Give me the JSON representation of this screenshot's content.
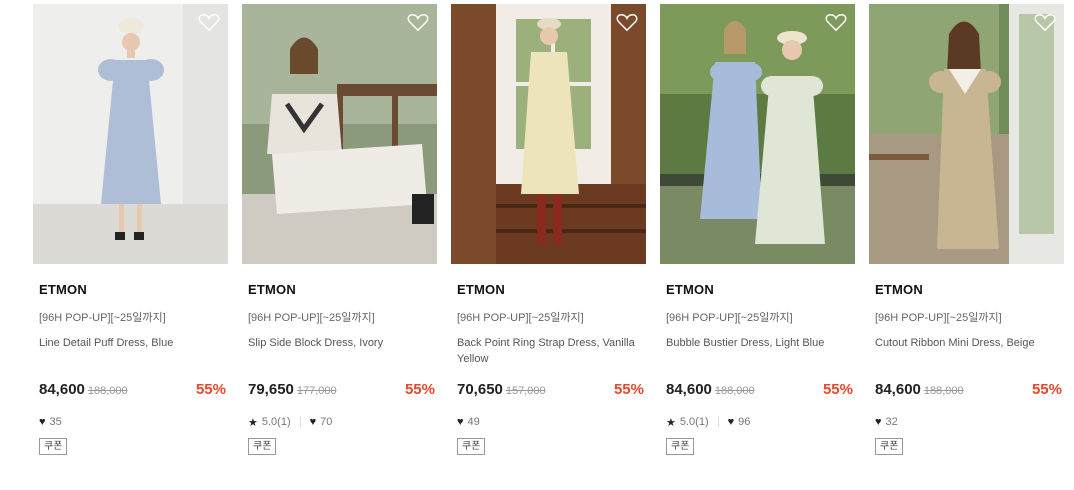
{
  "products": [
    {
      "brand": "ETMON",
      "tag": "[96H POP-UP][~25일까지]",
      "name": "Line Detail Puff Dress, Blue",
      "price": "84,600",
      "original_price": "188,000",
      "discount": "55%",
      "rating": "",
      "likes": "35",
      "coupon": "쿠폰",
      "colors": {
        "bg": "#e9e9e7",
        "floor": "#d9d7d2",
        "dress": "#a9bcd6"
      }
    },
    {
      "brand": "ETMON",
      "tag": "[96H POP-UP][~25일까지]",
      "name": "Slip Side Block Dress, Ivory",
      "price": "79,650",
      "original_price": "177,000",
      "discount": "55%",
      "rating": "5.0(1)",
      "likes": "70",
      "coupon": "쿠폰",
      "colors": {
        "bg": "#7a8c6a",
        "floor": "#6b4a33",
        "dress": "#ece8e0"
      }
    },
    {
      "brand": "ETMON",
      "tag": "[96H POP-UP][~25일까지]",
      "name": "Back Point Ring Strap Dress, Vanilla Yellow",
      "price": "70,650",
      "original_price": "157,000",
      "discount": "55%",
      "rating": "",
      "likes": "49",
      "coupon": "쿠폰",
      "colors": {
        "bg": "#8a5a3a",
        "floor": "#5e3520",
        "dress": "#efe6bf"
      }
    },
    {
      "brand": "ETMON",
      "tag": "[96H POP-UP][~25일까지]",
      "name": "Bubble Bustier Dress, Light Blue",
      "price": "84,600",
      "original_price": "188,000",
      "discount": "55%",
      "rating": "5.0(1)",
      "likes": "96",
      "coupon": "쿠폰",
      "colors": {
        "bg": "#5f7a45",
        "floor": "#8a9a6a",
        "dress": "#aabfdd"
      }
    },
    {
      "brand": "ETMON",
      "tag": "[96H POP-UP][~25일까지]",
      "name": "Cutout Ribbon Mini Dress, Beige",
      "price": "84,600",
      "original_price": "188,000",
      "discount": "55%",
      "rating": "",
      "likes": "32",
      "coupon": "쿠폰",
      "colors": {
        "bg": "#6e8a5a",
        "floor": "#a89a82",
        "dress": "#c7b48f"
      }
    }
  ],
  "icons": {
    "wishlist": "heart-outline-icon",
    "likes": "heart-filled-icon",
    "rating": "star-icon"
  }
}
